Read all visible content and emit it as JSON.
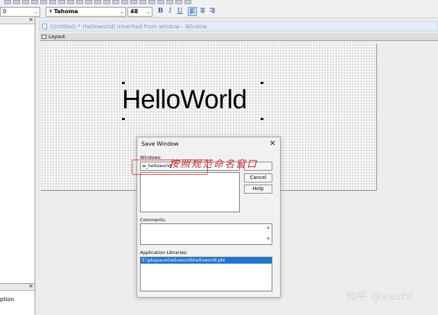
{
  "toolbar": {
    "style_value": "0",
    "font_name": "Tahoma",
    "font_size": "48",
    "bold": "B",
    "italic": "I",
    "underline": "U"
  },
  "painter": {
    "window_title": "(Untitled) * (helloworld) inherited from window - Window",
    "layout_tab": "Layout",
    "static_text": "HelloWorld"
  },
  "save_dialog": {
    "title": "Save Window",
    "windows_label": "Windows:",
    "window_name_value": "w_helloworld",
    "cancel_label": "Cancel",
    "help_label": "Help",
    "comments_label": "Comments:",
    "libraries_label": "Application Libraries:",
    "libraries": [
      "E:\\pbspace\\helloworld\\helloworld.pbl"
    ]
  },
  "annotation": {
    "text": "按照规范命名窗口"
  },
  "left_panel": {
    "bottom_label": "ption"
  },
  "watermark": "知乎 @xiezhr"
}
